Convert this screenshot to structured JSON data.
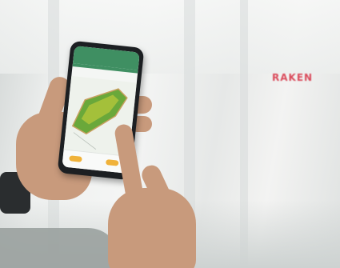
{
  "scene": {
    "background_color": "#e9ecec",
    "accent_app_green": "#3f8f62",
    "map_field_color": "#6aa83a",
    "map_highlight_color": "#d4d43a",
    "button_color": "#f0b23a"
  },
  "phone_app": {
    "title": "",
    "subtitle": "",
    "bottom_actions": []
  },
  "background_signage": {
    "text": "RAKEN"
  }
}
